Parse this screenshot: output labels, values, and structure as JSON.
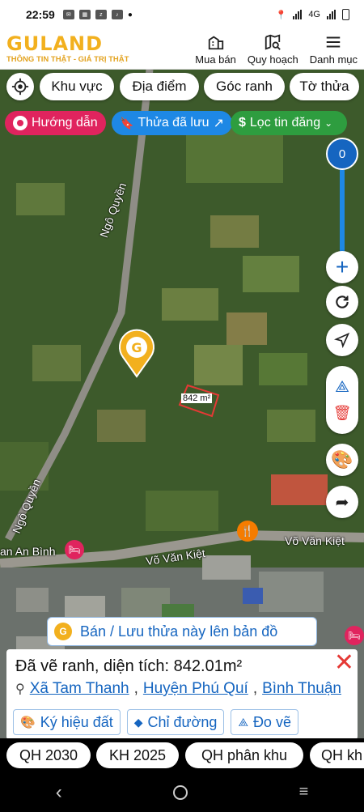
{
  "status_bar": {
    "time": "22:59",
    "network": "4G"
  },
  "header": {
    "logo": "GULAND",
    "tagline": "THÔNG TIN THẬT - GIÁ TRỊ THẬT",
    "nav": [
      "Mua bán",
      "Quy hoạch",
      "Danh mục"
    ]
  },
  "chips": [
    "Khu vực",
    "Địa điểm",
    "Góc ranh",
    "Tờ thửa"
  ],
  "pills": {
    "guide": "Hướng dẫn",
    "saved": "Thửa đã lưu",
    "filter": "Lọc tin đăng"
  },
  "zoom_value": "0",
  "map_labels": {
    "road_1": "Ngô Quyền",
    "road_2": "Ngô Quyền",
    "road_3": "Võ Văn Kiệt",
    "road_4": "Võ Văn Kiệt",
    "place": "an An Bình",
    "area": "842 m²"
  },
  "cta": "Bán / Lưu thửa này lên bản đồ",
  "card": {
    "title": "Đã vẽ ranh, diện tích: 842.01m²",
    "commune": "Xã Tam Thanh",
    "district": "Huyện Phú Quí",
    "province": "Bình Thuận",
    "sep": ",",
    "buttons": [
      "Ký hiệu đất",
      "Chỉ đường",
      "Đo vẽ"
    ]
  },
  "tabs": [
    "QH 2030",
    "KH 2025",
    "QH phân khu",
    "QH kh"
  ],
  "colors": {
    "accent": "#f2b01e",
    "blue": "#1565c0",
    "green": "#2e9d3f",
    "pink": "#e0245e"
  }
}
